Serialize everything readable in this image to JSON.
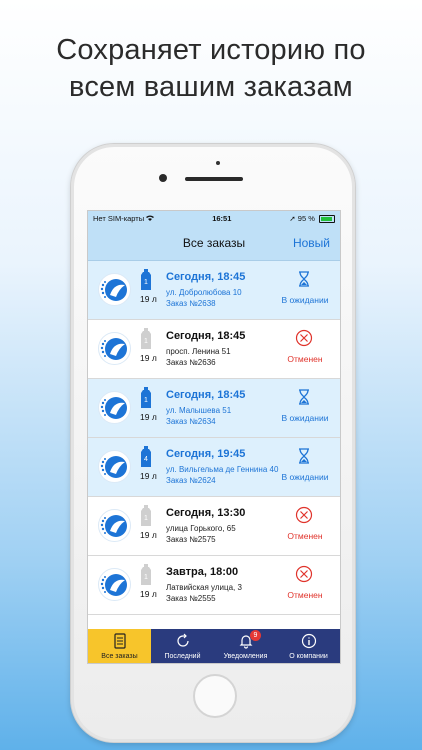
{
  "headline": {
    "line1": "Сохраняет историю по",
    "line2": "всем вашим заказам"
  },
  "status_bar": {
    "carrier": "Нет SIM-карты",
    "time": "16:51",
    "battery": "95 %"
  },
  "nav": {
    "title": "Все заказы",
    "new_label": "Новый"
  },
  "orders": [
    {
      "when": "Сегодня, 18:45",
      "address": "ул. Добролюбова 10",
      "order": "Заказ №2638",
      "qty": "1",
      "liters": "19 л",
      "status": "В ожидании",
      "status_type": "waiting",
      "active": true
    },
    {
      "when": "Сегодня, 18:45",
      "address": "просп. Ленина 51",
      "order": "Заказ №2636",
      "qty": "1",
      "liters": "19 л",
      "status": "Отменен",
      "status_type": "cancelled",
      "active": false
    },
    {
      "when": "Сегодня, 18:45",
      "address": "ул. Малышева 51",
      "order": "Заказ №2634",
      "qty": "1",
      "liters": "19 л",
      "status": "В ожидании",
      "status_type": "waiting",
      "active": true
    },
    {
      "when": "Сегодня, 19:45",
      "address": "ул. Вильгельма де Геннина 40",
      "order": "Заказ №2624",
      "qty": "4",
      "liters": "19 л",
      "status": "В ожидании",
      "status_type": "waiting",
      "active": true
    },
    {
      "when": "Сегодня, 13:30",
      "address": "улица Горького, 65",
      "order": "Заказ №2575",
      "qty": "1",
      "liters": "19 л",
      "status": "Отменен",
      "status_type": "cancelled",
      "active": false
    },
    {
      "when": "Завтра, 18:00",
      "address": "Латвийская улица, 3",
      "order": "Заказ №2555",
      "qty": "1",
      "liters": "19 л",
      "status": "Отменен",
      "status_type": "cancelled",
      "active": false
    }
  ],
  "tabs": [
    {
      "label": "Все заказы",
      "icon": "list-icon",
      "active": true
    },
    {
      "label": "Последний",
      "icon": "refresh-icon",
      "active": false
    },
    {
      "label": "Уведомления",
      "icon": "bell-icon",
      "active": false,
      "badge": "9"
    },
    {
      "label": "О компании",
      "icon": "info-icon",
      "active": false
    }
  ],
  "colors": {
    "accent": "#1d74d6",
    "cancel": "#e0332b",
    "nav_bg": "#bfe0f7",
    "tabbar_bg": "#2a3b7e",
    "tab_active": "#f7c52b"
  }
}
